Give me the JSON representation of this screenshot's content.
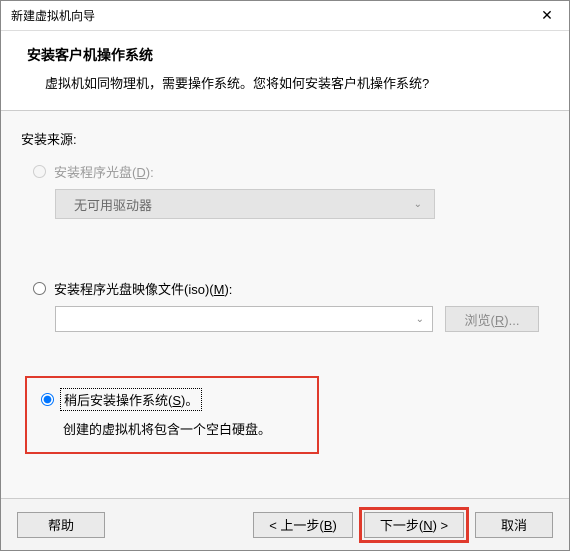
{
  "titlebar": {
    "title": "新建虚拟机向导"
  },
  "header": {
    "title": "安装客户机操作系统",
    "subtitle": "虚拟机如同物理机，需要操作系统。您将如何安装客户机操作系统?"
  },
  "content": {
    "source_label": "安装来源:",
    "opt_disc": {
      "label_pre": "安装程序光盘(",
      "hotkey": "D",
      "label_post": "):"
    },
    "drive_select": "无可用驱动器",
    "opt_iso": {
      "label_pre": "安装程序光盘映像文件(iso)(",
      "hotkey": "M",
      "label_post": "):"
    },
    "browse": {
      "label_pre": "浏览(",
      "hotkey": "R",
      "label_post": "..."
    },
    "opt_later": {
      "label_pre": "稍后安装操作系统(",
      "hotkey": "S",
      "label_post": ")。"
    },
    "later_hint": "创建的虚拟机将包含一个空白硬盘。"
  },
  "footer": {
    "help": "帮助",
    "back": {
      "pre": "< 上一步(",
      "hotkey": "B",
      "post": ")"
    },
    "next": {
      "pre": "下一步(",
      "hotkey": "N",
      "post": ") >"
    },
    "cancel": "取消"
  }
}
